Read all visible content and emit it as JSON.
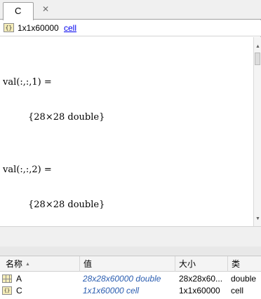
{
  "editor": {
    "tab_label": "C",
    "tab_close": "✕",
    "info": {
      "icon": "cell-array-icon",
      "icon_glyph": "{}",
      "size_text": "1x1x60000",
      "class_link": "cell"
    },
    "lines": [
      "val(:,:,1) =",
      "{28×28 double}",
      "val(:,:,2) =",
      "{28×28 double}"
    ]
  },
  "workspace": {
    "columns": {
      "name": "名称",
      "value": "值",
      "size": "大小",
      "class": "类"
    },
    "rows": [
      {
        "icon": "matrix-icon",
        "name": "A",
        "value": "28x28x60000 double",
        "size": "28x28x60...",
        "class": "double"
      },
      {
        "icon": "cell-array-icon",
        "icon_glyph": "{}",
        "name": "C",
        "value": "1x1x60000 cell",
        "size": "1x1x60000",
        "class": "cell"
      }
    ]
  }
}
